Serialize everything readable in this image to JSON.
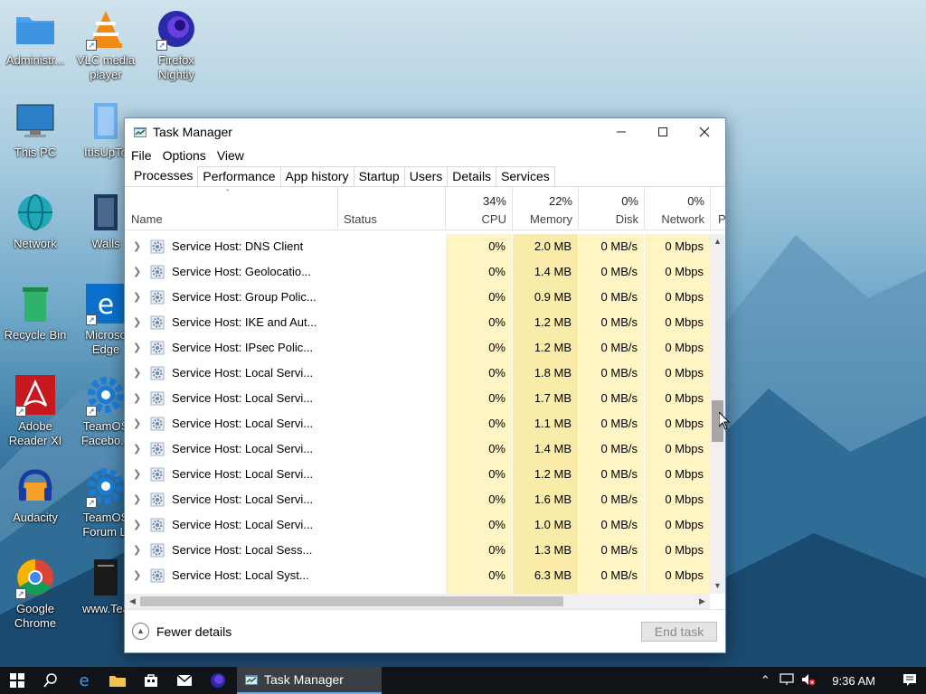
{
  "desktop": {
    "icons": [
      {
        "label": "Administr...",
        "icon": "folder-icon"
      },
      {
        "label": "VLC media player",
        "icon": "vlc-icon"
      },
      {
        "label": "Firefox Nightly",
        "icon": "firefox-nightly-icon"
      },
      {
        "label": "This PC",
        "icon": "monitor-icon"
      },
      {
        "label": "ItIsUpTo",
        "icon": "file-icon"
      },
      {
        "label": "Network",
        "icon": "globe-icon"
      },
      {
        "label": "Walls",
        "icon": "file-icon"
      },
      {
        "label": "Recycle Bin",
        "icon": "recycle-bin-icon"
      },
      {
        "label": "Microso Edge",
        "icon": "edge-icon"
      },
      {
        "label": "Adobe Reader XI",
        "icon": "adobe-reader-icon"
      },
      {
        "label": "TeamOS Facebo...",
        "icon": "gear-icon"
      },
      {
        "label": "Audacity",
        "icon": "audacity-icon"
      },
      {
        "label": "TeamOS Forum Li",
        "icon": "gear-icon"
      },
      {
        "label": "Google Chrome",
        "icon": "chrome-icon"
      },
      {
        "label": "www.Tea",
        "icon": "file-icon"
      }
    ]
  },
  "window": {
    "title": "Task Manager",
    "menu": [
      "File",
      "Options",
      "View"
    ],
    "tabs": [
      "Processes",
      "Performance",
      "App history",
      "Startup",
      "Users",
      "Details",
      "Services"
    ],
    "columns": {
      "name": "Name",
      "status": "Status",
      "cpu": {
        "pct": "34%",
        "label": "CPU"
      },
      "memory": {
        "pct": "22%",
        "label": "Memory"
      },
      "disk": {
        "pct": "0%",
        "label": "Disk"
      },
      "network": {
        "pct": "0%",
        "label": "Network"
      },
      "power": "P"
    },
    "rows": [
      {
        "name": "Service Host: DNS Client",
        "cpu": "0%",
        "memory": "2.0 MB",
        "disk": "0 MB/s",
        "network": "0 Mbps"
      },
      {
        "name": "Service Host: Geolocatio...",
        "cpu": "0%",
        "memory": "1.4 MB",
        "disk": "0 MB/s",
        "network": "0 Mbps"
      },
      {
        "name": "Service Host: Group Polic...",
        "cpu": "0%",
        "memory": "0.9 MB",
        "disk": "0 MB/s",
        "network": "0 Mbps"
      },
      {
        "name": "Service Host: IKE and Aut...",
        "cpu": "0%",
        "memory": "1.2 MB",
        "disk": "0 MB/s",
        "network": "0 Mbps"
      },
      {
        "name": "Service Host: IPsec Polic...",
        "cpu": "0%",
        "memory": "1.2 MB",
        "disk": "0 MB/s",
        "network": "0 Mbps"
      },
      {
        "name": "Service Host: Local Servi...",
        "cpu": "0%",
        "memory": "1.8 MB",
        "disk": "0 MB/s",
        "network": "0 Mbps"
      },
      {
        "name": "Service Host: Local Servi...",
        "cpu": "0%",
        "memory": "1.7 MB",
        "disk": "0 MB/s",
        "network": "0 Mbps"
      },
      {
        "name": "Service Host: Local Servi...",
        "cpu": "0%",
        "memory": "1.1 MB",
        "disk": "0 MB/s",
        "network": "0 Mbps"
      },
      {
        "name": "Service Host: Local Servi...",
        "cpu": "0%",
        "memory": "1.4 MB",
        "disk": "0 MB/s",
        "network": "0 Mbps"
      },
      {
        "name": "Service Host: Local Servi...",
        "cpu": "0%",
        "memory": "1.2 MB",
        "disk": "0 MB/s",
        "network": "0 Mbps"
      },
      {
        "name": "Service Host: Local Servi...",
        "cpu": "0%",
        "memory": "1.6 MB",
        "disk": "0 MB/s",
        "network": "0 Mbps"
      },
      {
        "name": "Service Host: Local Servi...",
        "cpu": "0%",
        "memory": "1.0 MB",
        "disk": "0 MB/s",
        "network": "0 Mbps"
      },
      {
        "name": "Service Host: Local Sess...",
        "cpu": "0%",
        "memory": "1.3 MB",
        "disk": "0 MB/s",
        "network": "0 Mbps"
      },
      {
        "name": "Service Host: Local Syst...",
        "cpu": "0%",
        "memory": "6.3 MB",
        "disk": "0 MB/s",
        "network": "0 Mbps"
      }
    ],
    "footer": {
      "fewer_details": "Fewer details",
      "end_task": "End task"
    }
  },
  "taskbar": {
    "active_app": "Task Manager",
    "clock": "9:36 AM"
  },
  "colors": {
    "cpu_col_bg": "#fff4c4",
    "mem_col_bg": "#f9eca8",
    "taskbar_bg": "#101418"
  }
}
